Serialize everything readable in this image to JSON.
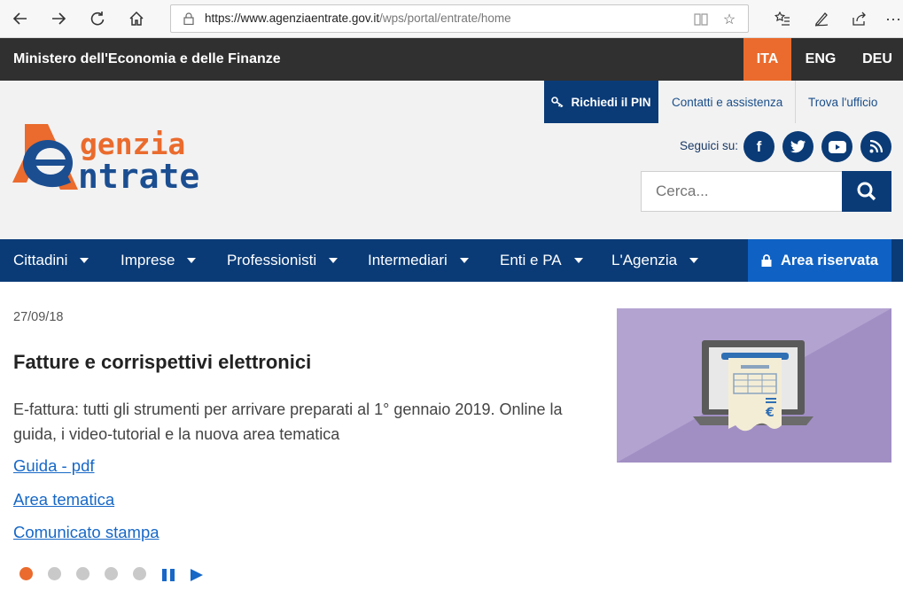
{
  "browser": {
    "url_host": "https://www.agenziaentrate.gov.it",
    "url_path": "/wps/portal/entrate/home",
    "icons": [
      "back-icon",
      "forward-icon",
      "refresh-icon",
      "home-icon",
      "lock-icon",
      "reading-view-icon",
      "favorite-star-icon",
      "favorites-list-icon",
      "pen-icon",
      "share-icon",
      "more-icon"
    ]
  },
  "ministry": {
    "title": "Ministero dell'Economia e delle Finanze",
    "languages": [
      "ITA",
      "ENG",
      "DEU"
    ],
    "active_language": "ITA"
  },
  "header": {
    "pin_label": "Richiedi il PIN",
    "contact_label": "Contatti e assistenza",
    "office_label": "Trova l'ufficio",
    "follow_label": "Seguici su:",
    "social": [
      "facebook-icon",
      "twitter-icon",
      "youtube-icon",
      "rss-icon"
    ],
    "search_placeholder": "Cerca...",
    "logo_line1": "genzia",
    "logo_line2": "ntrate"
  },
  "nav": {
    "items": [
      "Cittadini",
      "Imprese",
      "Professionisti",
      "Intermediari",
      "Enti e PA",
      "L'Agenzia"
    ],
    "area_label": "Area riservata"
  },
  "news": {
    "date": "27/09/18",
    "headline": "Fatture e corrispettivi elettronici",
    "lead": "E-fattura: tutti gli strumenti per arrivare preparati al 1° gennaio 2019. Online la guida, i video-tutorial e la nuova area tematica",
    "links": [
      "Guida - pdf",
      "Area tematica",
      "Comunicato stampa"
    ],
    "slides_total": 5,
    "active_slide": 1
  },
  "colors": {
    "navy": "#0a3b77",
    "orange": "#ea6b2d",
    "link_blue": "#1768c7",
    "dark_bar": "#303030"
  }
}
